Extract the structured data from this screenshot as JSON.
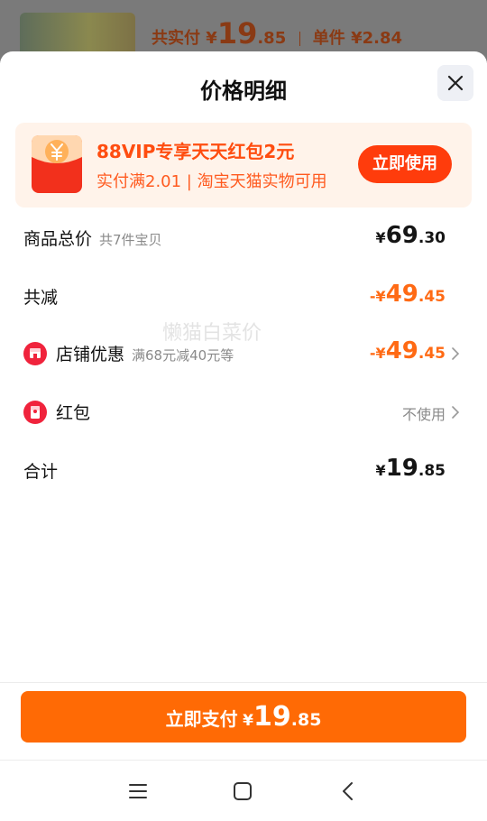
{
  "background": {
    "paid_label": "共实付",
    "paid_currency": "¥",
    "paid_int": "19",
    "paid_dec": ".85",
    "unit_label": "单件",
    "unit_price": "¥2.84"
  },
  "sheet": {
    "title": "价格明细",
    "close_icon": "close-icon"
  },
  "promo": {
    "icon": "red-envelope-yuan-icon",
    "title": "88VIP专享天天红包2元",
    "subtitle": "实付满2.01 | 淘宝天猫实物可用",
    "button": "立即使用"
  },
  "rows": {
    "total": {
      "label": "商品总价",
      "hint": "共7件宝贝",
      "currency": "¥",
      "int": "69",
      "dec": ".30"
    },
    "reduced": {
      "label": "共减",
      "currency": "-¥",
      "int": "49",
      "dec": ".45"
    },
    "shop": {
      "label": "店铺优惠",
      "hint": "满68元减40元等",
      "currency": "-¥",
      "int": "49",
      "dec": ".45"
    },
    "redpacket": {
      "label": "红包",
      "value": "不使用"
    },
    "sum": {
      "label": "合计",
      "currency": "¥",
      "int": "19",
      "dec": ".85"
    }
  },
  "watermark": "懒猫白菜价",
  "pay": {
    "label": "立即支付",
    "currency": "¥",
    "int": "19",
    "dec": ".85"
  },
  "colors": {
    "accent": "#ff6a05",
    "promo_red": "#ff3c0c",
    "discount": "#ff6a14"
  },
  "navbar": [
    "menu-icon",
    "home-square-icon",
    "back-chevron-icon"
  ]
}
